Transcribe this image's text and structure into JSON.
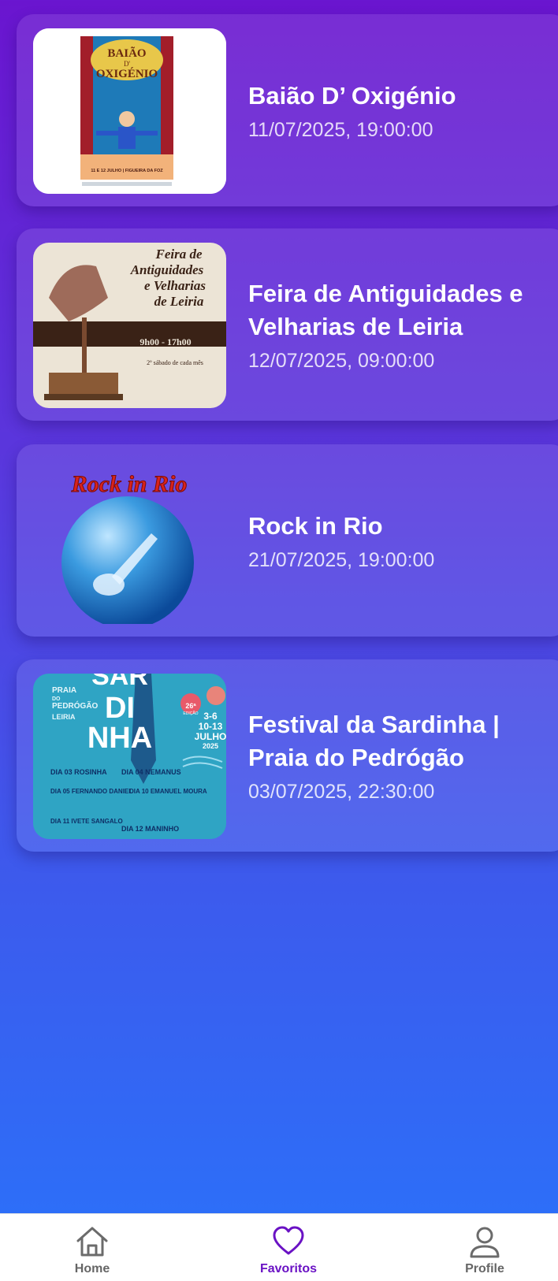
{
  "events": [
    {
      "title": "Baião D’ Oxigénio",
      "date": "11/07/2025, 19:00:00",
      "image_icon": "poster-baiao-oxigenio",
      "poster_text": {
        "line1": "BAIÃO",
        "line2": "D'",
        "line3": "OXIGÉNIO",
        "footer": "11 E 12 JULHO | FIGUEIRA DA FOZ"
      }
    },
    {
      "title": "Feira de Antiguidades e Velharias de Leiria",
      "date": "12/07/2025, 09:00:00",
      "image_icon": "poster-feira-antiguidades",
      "poster_text": {
        "line1": "Feira de",
        "line2": "Antiguidades",
        "line3": "e Velharias",
        "line4": "de Leiria",
        "hours": "9h00 - 17h00",
        "note": "2º sábado de cada mês"
      }
    },
    {
      "title": "Rock in Rio",
      "date": "21/07/2025, 19:00:00",
      "image_icon": "rock-in-rio-logo",
      "poster_text": {
        "logo": "Rock in Rio"
      }
    },
    {
      "title": "Festival da Sardinha | Praia do Pedrógão",
      "date": "03/07/2025, 22:30:00",
      "image_icon": "poster-festival-sardinha",
      "poster_text": {
        "place1": "PRAIA",
        "place2": "DO",
        "place3": "PEDRÓGÃO",
        "place4": "LEIRIA",
        "big1": "SAR",
        "big2": "DI",
        "big3": "NHA",
        "edition": "26ª",
        "edition2": "EDIÇÃO",
        "dates1": "3-6",
        "dates2": "10-13",
        "month": "JULHO",
        "year": "2025",
        "a1": "DIA 03 ROSINHA",
        "a2": "DIA 04 NEMANUS",
        "a3": "DIA 05 FERNANDO DANIEL",
        "a4": "DIA 10 EMANUEL MOURA",
        "a5": "DIA 11 IVETE SANGALO",
        "a6": "DIA 12 MANINHO"
      }
    }
  ],
  "nav": [
    {
      "label": "Home",
      "icon": "home-icon",
      "active": false
    },
    {
      "label": "Favoritos",
      "icon": "heart-icon",
      "active": true
    },
    {
      "label": "Profile",
      "icon": "user-icon",
      "active": false
    }
  ],
  "colors": {
    "active": "#6a12c4",
    "inactive": "#666666",
    "gradient_top": "#6a15cf",
    "gradient_bottom": "#2a72fa"
  }
}
